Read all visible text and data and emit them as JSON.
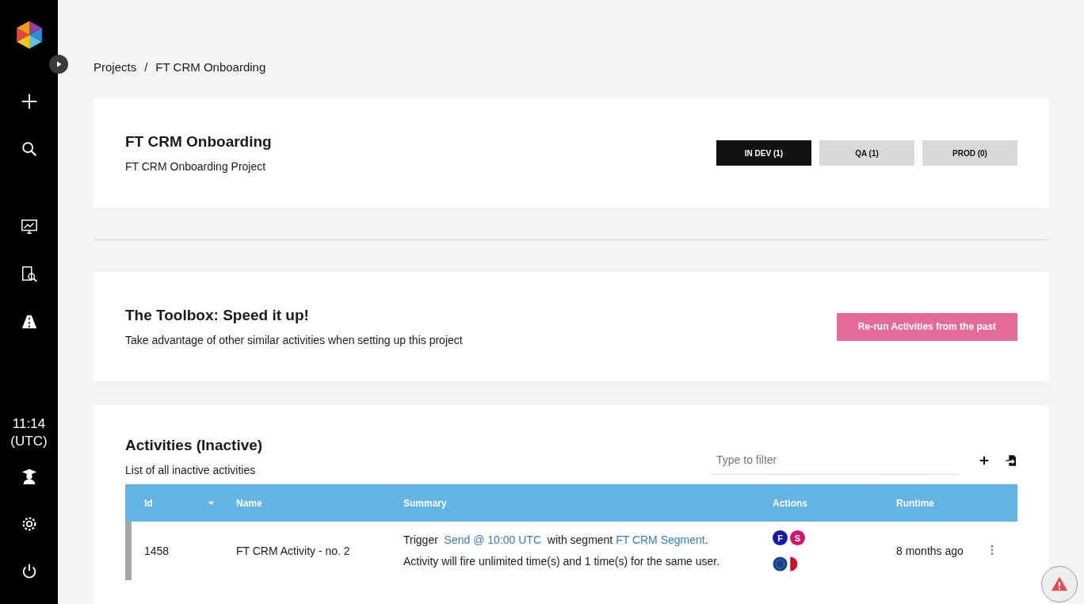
{
  "sidebar": {
    "clock": {
      "time": "11:14",
      "zone": "(UTC)"
    }
  },
  "breadcrumb": {
    "items": [
      "Projects",
      "FT CRM Onboarding"
    ],
    "separator": "/"
  },
  "project": {
    "title": "FT CRM Onboarding",
    "description": "FT CRM Onboarding Project",
    "environments": [
      {
        "label": "IN DEV (1)",
        "selected": true
      },
      {
        "label": "QA (1)",
        "selected": false
      },
      {
        "label": "PROD (0)",
        "selected": false
      }
    ]
  },
  "toolbox": {
    "title": "The Toolbox: Speed it up!",
    "description": "Take advantage of other similar activities when setting up this project",
    "button": "Re-run Activities from the past"
  },
  "activities": {
    "title": "Activities (Inactive)",
    "description": "List of all inactive activities",
    "filter": {
      "placeholder": "Type to filter"
    },
    "table": {
      "columns": [
        "Id",
        "Name",
        "Summary",
        "Actions",
        "Runtime"
      ],
      "rows": [
        {
          "id": "1458",
          "name": "FT CRM Activity - no. 2",
          "summary": {
            "before": "Trigger",
            "trigger": "Send @ 10:00 UTC",
            "middle": "with segment",
            "segment": "FT CRM Segment",
            "after": ".",
            "line_2": "Activity will fire unlimited time(s) and 1 time(s) for the same user."
          },
          "badges": [
            {
              "letter": "F",
              "color": "#1a1aa8"
            },
            {
              "letter": "S",
              "color": "#d6146a"
            }
          ],
          "runtime": "8 months ago"
        }
      ]
    }
  }
}
